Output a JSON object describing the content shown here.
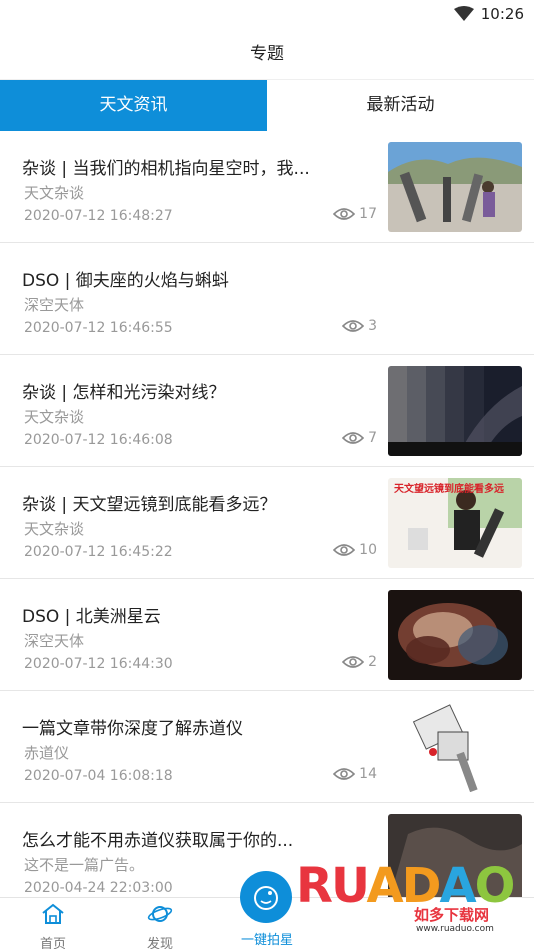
{
  "status_bar": {
    "time": "10:26"
  },
  "header": {
    "title": "专题"
  },
  "tabs": [
    {
      "label": "天文资讯",
      "active": true
    },
    {
      "label": "最新活动",
      "active": false
    }
  ],
  "articles": [
    {
      "title": "杂谈 | 当我们的相机指向星空时，我...",
      "category": "天文杂谈",
      "date": "2020-07-12 16:48:27",
      "views": "17",
      "thumb": "telescopes-outdoor-photo"
    },
    {
      "title": "DSO | 御夫座的火焰与蝌蚪",
      "category": "深空天体",
      "date": "2020-07-12 16:46:55",
      "views": "3",
      "thumb": ""
    },
    {
      "title": "杂谈 | 怎样和光污染对线？",
      "category": "天文杂谈",
      "date": "2020-07-12 16:46:08",
      "views": "7",
      "thumb": "night-sky-gradient-photo"
    },
    {
      "title": "杂谈 | 天文望远镜到底能看多远？",
      "category": "天文杂谈",
      "date": "2020-07-12 16:45:22",
      "views": "10",
      "thumb": "person-with-telescope-photo",
      "thumb_text": "天文望远镜到底能看多远"
    },
    {
      "title": "DSO | 北美洲星云",
      "category": "深空天体",
      "date": "2020-07-12 16:44:30",
      "views": "2",
      "thumb": "nebula-photo"
    },
    {
      "title": "一篇文章带你深度了解赤道仪",
      "category": "赤道仪",
      "date": "2020-07-04 16:08:18",
      "views": "14",
      "thumb": "equatorial-mount-photo"
    },
    {
      "title": "怎么才能不用赤道仪获取属于你的...",
      "category": "这不是一篇广告。",
      "date": "2020-04-24 22:03:00",
      "views": "",
      "thumb": "dark-photo"
    }
  ],
  "bottom_nav": {
    "home_label": "首页",
    "discover_label": "发现",
    "shoot_label": "一键拍星"
  },
  "watermark": {
    "logo": "RUANDAO",
    "name": "如多下载网",
    "url": "www.ruaduo.com"
  },
  "colors": {
    "accent": "#0e8ed9",
    "muted_text": "#999999"
  }
}
